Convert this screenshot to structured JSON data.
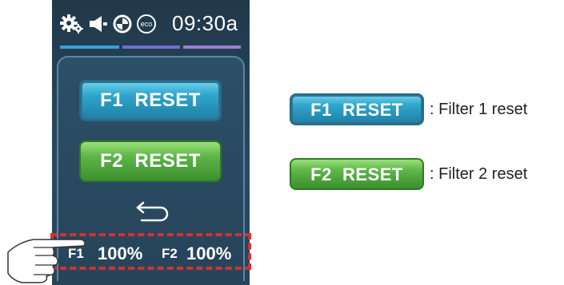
{
  "status_bar": {
    "icons": [
      "gear-icon",
      "speaker-icon",
      "swirl-icon",
      "eco-icon"
    ],
    "eco_label": "eco",
    "time": "09:30a"
  },
  "device": {
    "f1_button": "F1  RESET",
    "f2_button": "F2  RESET",
    "back_icon": "return-arrow-icon",
    "filter_status": {
      "f1_label": "F1",
      "f1_value": "100%",
      "f2_label": "F2",
      "f2_value": "100%"
    }
  },
  "legend": {
    "f1_button": "F1  RESET",
    "f1_text": ": Filter 1 reset",
    "f2_button": "F2  RESET",
    "f2_text": ": Filter 2 reset"
  },
  "colors": {
    "f1_button": "#2fa6cc",
    "f2_button": "#5fb84a",
    "highlight_dash": "#d1322f",
    "screen_bg": "#2a4a60"
  }
}
